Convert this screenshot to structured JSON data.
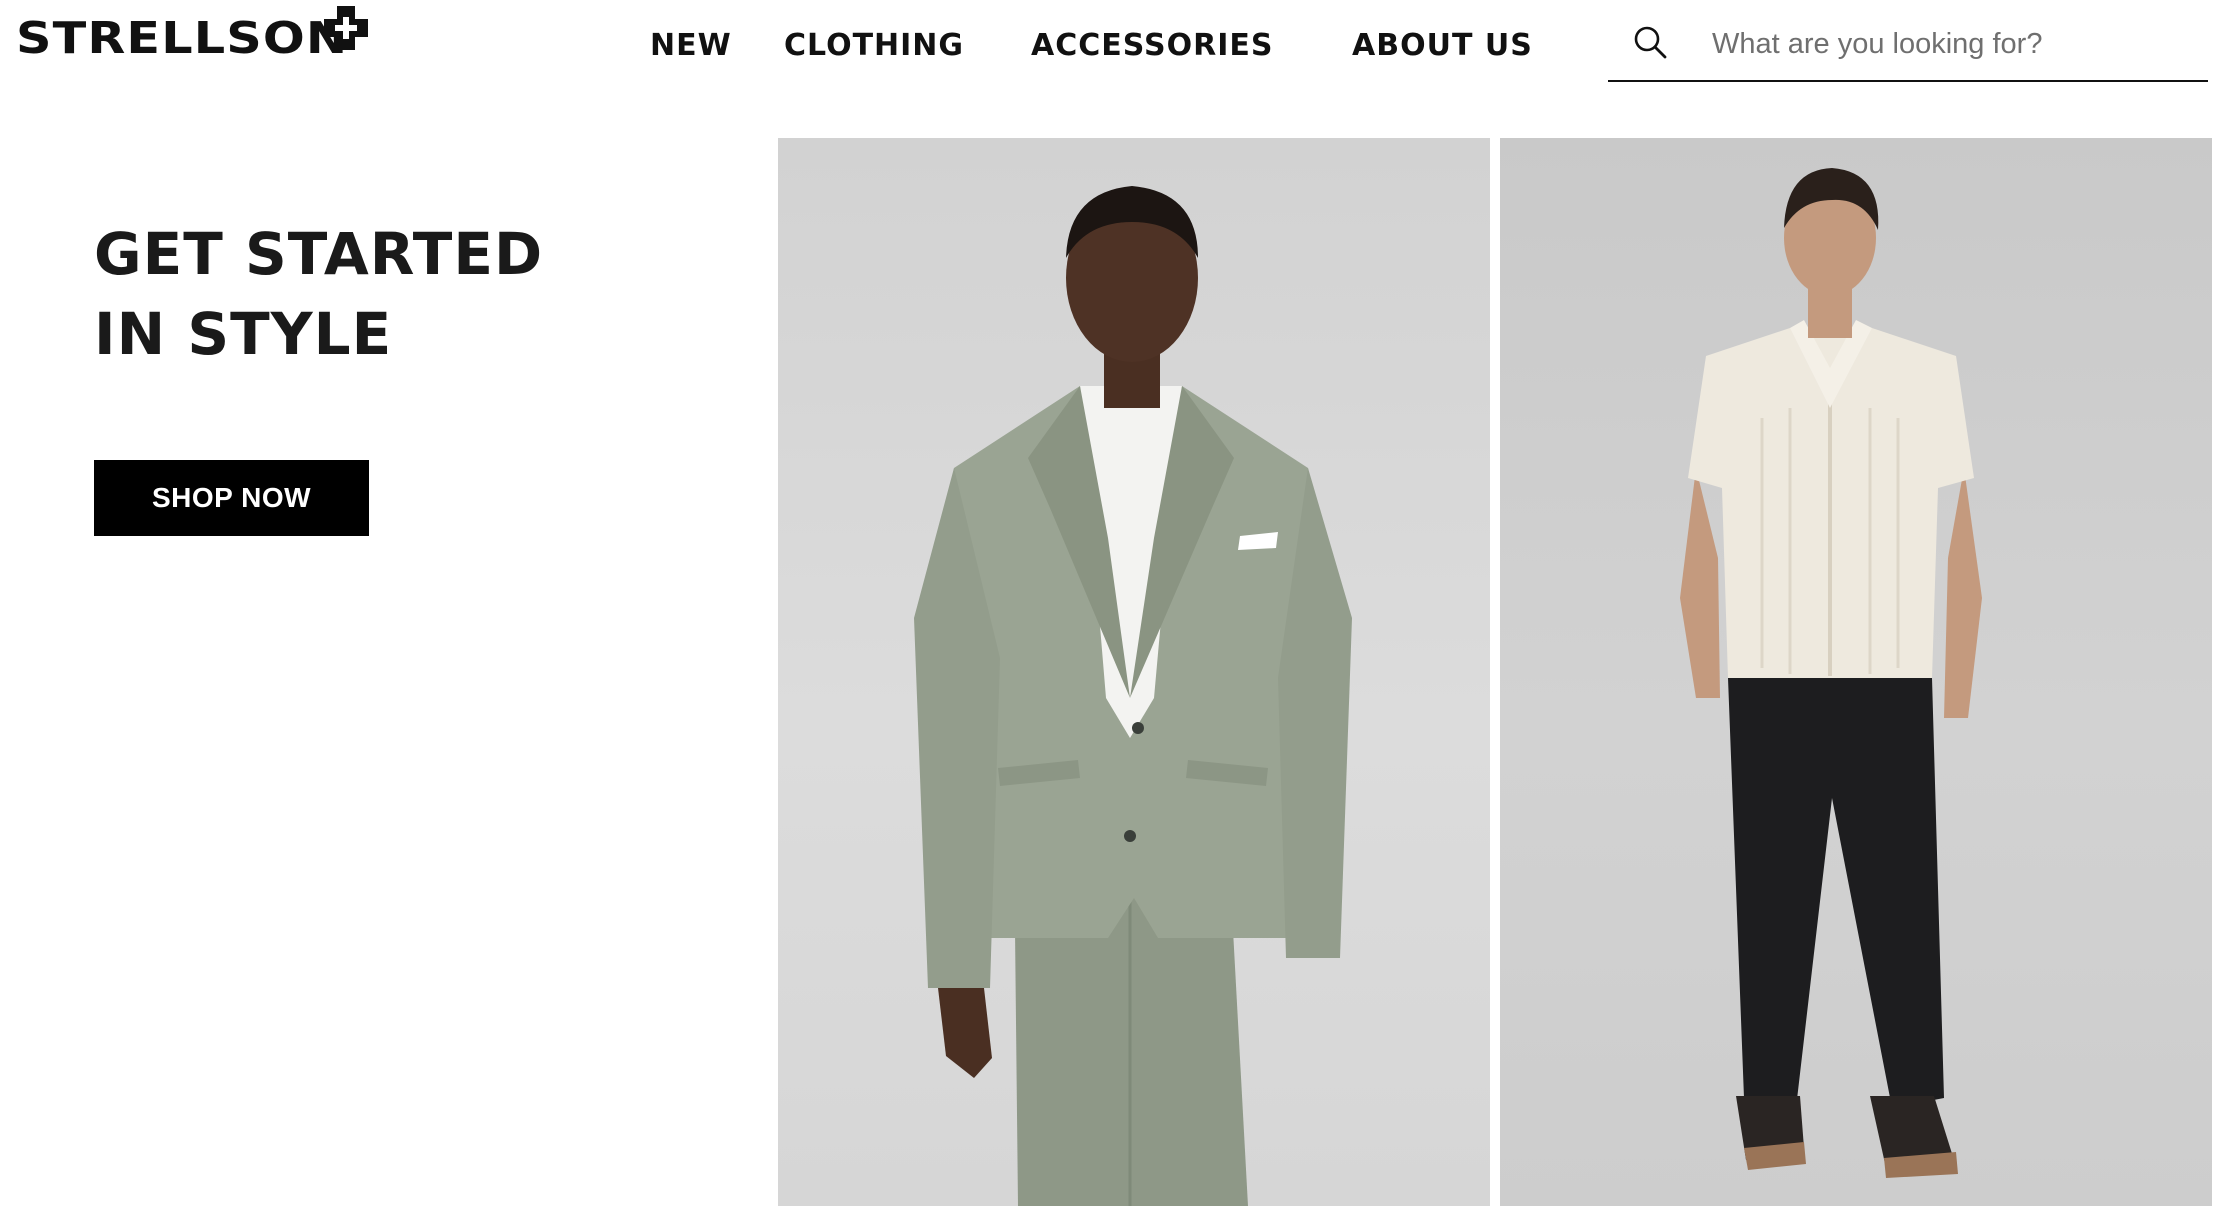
{
  "brand": {
    "name": "STRELLSON",
    "logo_icon": "cross-mark-icon"
  },
  "nav": {
    "items": [
      {
        "label": "NEW"
      },
      {
        "label": "CLOTHING"
      },
      {
        "label": "ACCESSORIES"
      },
      {
        "label": "ABOUT US"
      }
    ]
  },
  "search": {
    "icon": "search-icon",
    "placeholder": "What are you looking for?",
    "value": ""
  },
  "hero": {
    "title_line1": "GET STARTED",
    "title_line2": "IN STYLE",
    "cta_label": "SHOP NOW",
    "images": [
      {
        "name": "model-green-suit-image"
      },
      {
        "name": "model-knit-shirt-image"
      }
    ]
  },
  "colors": {
    "text": "#111111",
    "button_bg": "#000000",
    "button_text": "#ffffff",
    "background": "#ffffff"
  }
}
